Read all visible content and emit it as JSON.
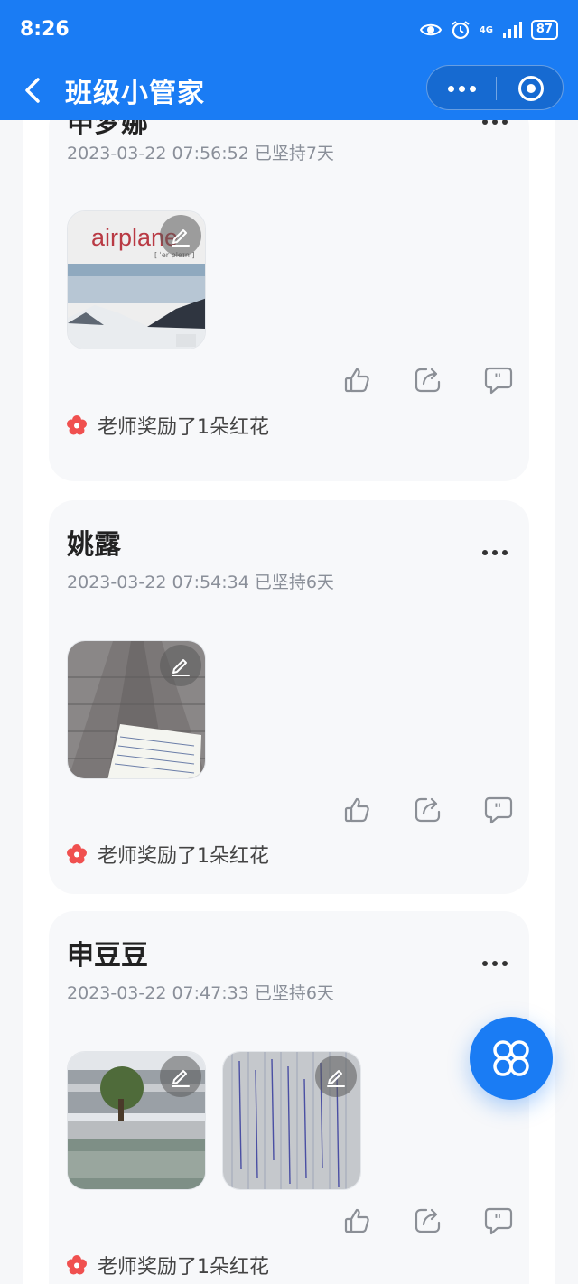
{
  "status": {
    "time": "8:26",
    "network": "4G",
    "battery": "87"
  },
  "nav": {
    "title": "班级小管家"
  },
  "posts": [
    {
      "name": "申梦娜",
      "meta": "2023-03-22 07:56:52 已坚持7天",
      "reward": "老师奖励了1朵红花",
      "photo_text": "airplane",
      "photo_subtext": "[ ˈer pleɪn ]"
    },
    {
      "name": "姚露",
      "meta": "2023-03-22 07:54:34 已坚持6天",
      "reward": "老师奖励了1朵红花"
    },
    {
      "name": "申豆豆",
      "meta": "2023-03-22 07:47:33 已坚持6天",
      "reward": "老师奖励了1朵红花"
    }
  ],
  "colors": {
    "primary": "#1a7cf4",
    "reward_flower": "#f0504f",
    "meta_gray": "#8a8f99"
  },
  "icons": [
    "back-icon",
    "more-icon",
    "target-icon",
    "edit-icon",
    "like-icon",
    "share-icon",
    "comment-icon",
    "flower-icon",
    "apps-icon"
  ]
}
